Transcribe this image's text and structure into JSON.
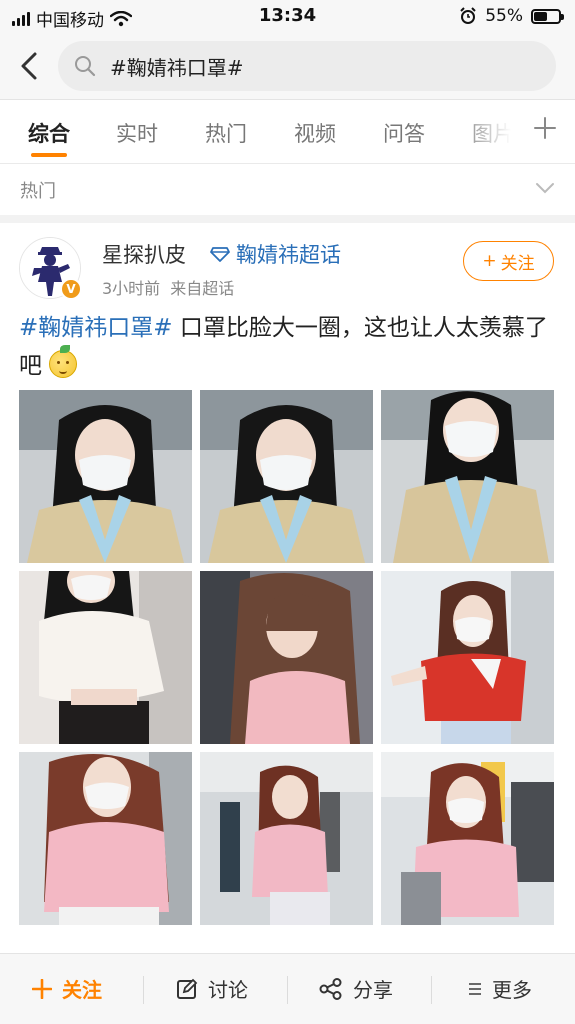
{
  "status_bar": {
    "carrier": "中国移动",
    "time": "13:34",
    "battery": "55%",
    "battery_level": 0.55
  },
  "search": {
    "query": "#鞠婧祎口罩#",
    "back_icon": "back-arrow-icon",
    "search_icon": "search-icon"
  },
  "tabs": [
    {
      "label": "综合",
      "active": true
    },
    {
      "label": "实时",
      "active": false
    },
    {
      "label": "热门",
      "active": false
    },
    {
      "label": "视频",
      "active": false
    },
    {
      "label": "问答",
      "active": false
    },
    {
      "label": "图片",
      "active": false
    }
  ],
  "filter": {
    "label": "热门"
  },
  "post": {
    "author": "星探扒皮",
    "topic": "鞠婧祎超话",
    "time": "3小时前",
    "source": "来自超话",
    "follow_label": "关注",
    "verified_mark": "V",
    "hashtag": "#鞠婧祎口罩#",
    "text": " 口罩比脸大一圈，这也让人太羡慕了吧"
  },
  "bottom_bar": {
    "follow": "关注",
    "discuss": "讨论",
    "share": "分享",
    "more": "更多"
  },
  "colors": {
    "accent": "#ff8200",
    "link": "#2a6fb8",
    "verified": "#f09b1a"
  }
}
